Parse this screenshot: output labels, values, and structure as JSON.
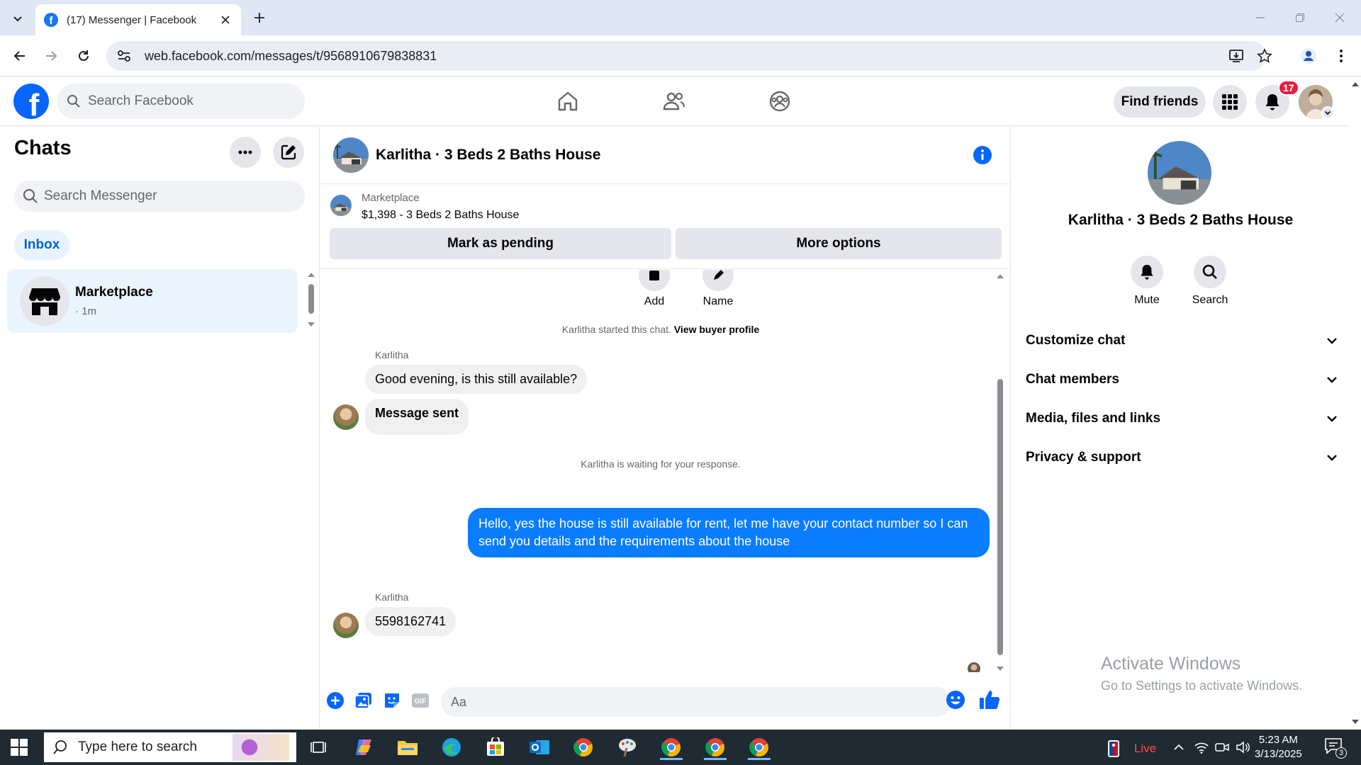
{
  "browser": {
    "tab_title": "(17) Messenger | Facebook",
    "url": "web.facebook.com/messages/t/9568910679838831"
  },
  "header": {
    "logo_letter": "f",
    "search_placeholder": "Search Facebook",
    "find_friends_label": "Find friends",
    "notification_count": "17"
  },
  "sidebar": {
    "title": "Chats",
    "search_placeholder": "Search Messenger",
    "filter_label": "Inbox",
    "conversations": [
      {
        "name": "Marketplace",
        "time": "· 1m"
      }
    ]
  },
  "conversation": {
    "title": "Karlitha · 3 Beds 2 Baths House",
    "banner_label": "Marketplace",
    "listing": "$1,398 - 3 Beds 2 Baths House",
    "pending_button": "Mark as pending",
    "more_options_button": "More options",
    "quick_actions": [
      {
        "label": "Add"
      },
      {
        "label": "Name"
      }
    ],
    "started_text": "Karlitha started this chat.",
    "buyer_profile_link": "View buyer profile",
    "messages": [
      {
        "sender": "Karlitha",
        "text": "Good evening, is this still available?"
      },
      {
        "text": "Message sent"
      },
      {
        "text": "Hello, yes the house is still available for rent, let me have your contact number so I can send you details and the requirements about the house"
      },
      {
        "sender": "Karlitha",
        "text": "5598162741"
      }
    ],
    "waiting_text": "Karlitha is waiting for your response.",
    "composer_placeholder": "Aa"
  },
  "details": {
    "name": "Karlitha · 3 Beds 2 Baths House",
    "actions": [
      {
        "label": "Mute"
      },
      {
        "label": "Search"
      }
    ],
    "sections": [
      {
        "label": "Customize chat"
      },
      {
        "label": "Chat members"
      },
      {
        "label": "Media, files and links"
      },
      {
        "label": "Privacy & support"
      }
    ],
    "watermark_title": "Activate Windows",
    "watermark_subtitle": "Go to Settings to activate Windows."
  },
  "taskbar": {
    "search_placeholder": "Type here to search",
    "live_label": "Live",
    "time": "5:23 AM",
    "date": "3/13/2025",
    "notification_count": "3"
  },
  "colors": {
    "facebook_blue": "#0866ff",
    "messenger_bubble": "#0a7cff",
    "badge_red": "#e41e3f",
    "inbox_pill": "#e7f3ff"
  }
}
